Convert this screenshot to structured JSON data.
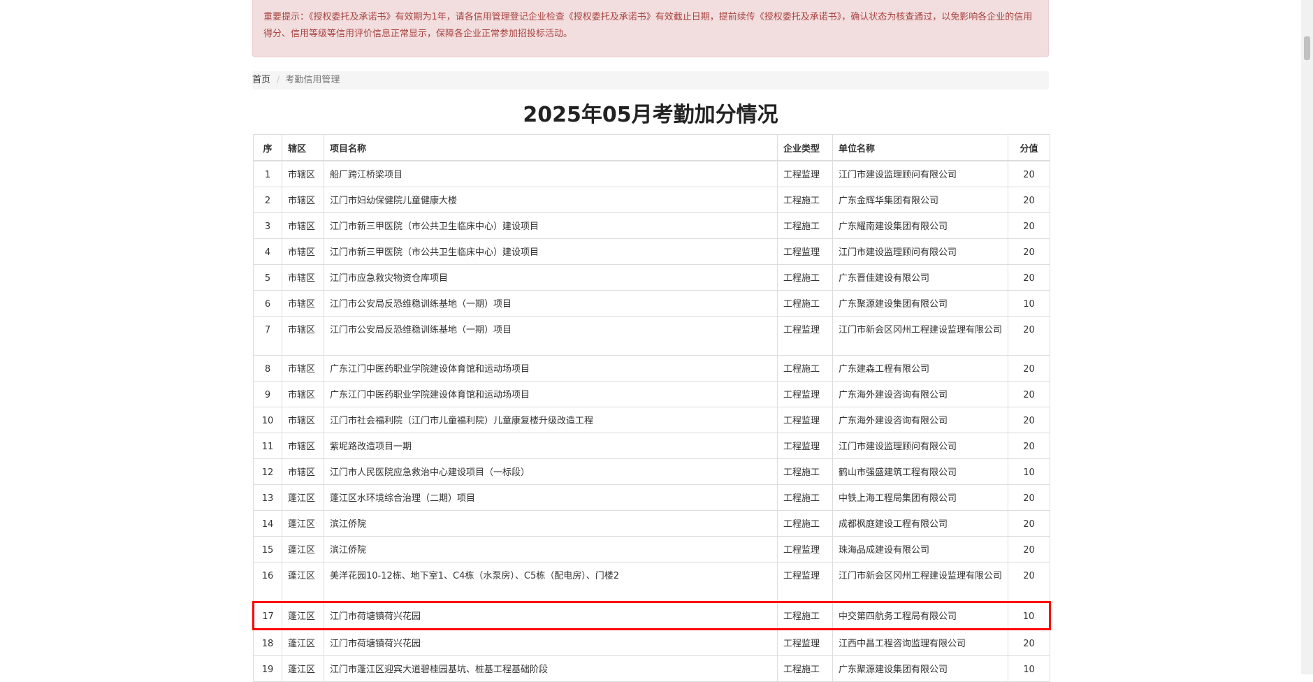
{
  "notice": "重要提示：《授权委托及承诺书》有效期为1年，请各信用管理登记企业检查《授权委托及承诺书》有效截止日期，提前续传《授权委托及承诺书》，确认状态为核查通过，以免影响各企业的信用得分、信用等级等信用评价信息正常显示，保障各企业正常参加招投标活动。",
  "breadcrumb": {
    "home": "首页",
    "separator": "/",
    "current": "考勤信用管理"
  },
  "title": "2025年05月考勤加分情况",
  "table": {
    "headers": [
      "序",
      "辖区",
      "项目名称",
      "企业类型",
      "单位名称",
      "分值"
    ],
    "rows": [
      [
        "1",
        "市辖区",
        "船厂跨江桥梁项目",
        "工程监理",
        "江门市建设监理顾问有限公司",
        "20"
      ],
      [
        "2",
        "市辖区",
        "江门市妇幼保健院儿童健康大楼",
        "工程施工",
        "广东金辉华集团有限公司",
        "20"
      ],
      [
        "3",
        "市辖区",
        "江门市新三甲医院（市公共卫生临床中心）建设项目",
        "工程施工",
        "广东耀南建设集团有限公司",
        "20"
      ],
      [
        "4",
        "市辖区",
        "江门市新三甲医院（市公共卫生临床中心）建设项目",
        "工程监理",
        "江门市建设监理顾问有限公司",
        "20"
      ],
      [
        "5",
        "市辖区",
        "江门市应急救灾物资仓库项目",
        "工程施工",
        "广东晋佳建设有限公司",
        "20"
      ],
      [
        "6",
        "市辖区",
        "江门市公安局反恐维稳训练基地（一期）项目",
        "工程施工",
        "广东聚源建设集团有限公司",
        "10"
      ],
      [
        "7",
        "市辖区",
        "江门市公安局反恐维稳训练基地（一期）项目",
        "工程监理",
        "江门市新会区冈州工程建设监理有限公司",
        "20"
      ],
      [
        "8",
        "市辖区",
        "广东江门中医药职业学院建设体育馆和运动场项目",
        "工程施工",
        "广东建森工程有限公司",
        "20"
      ],
      [
        "9",
        "市辖区",
        "广东江门中医药职业学院建设体育馆和运动场项目",
        "工程监理",
        "广东海外建设咨询有限公司",
        "20"
      ],
      [
        "10",
        "市辖区",
        "江门市社会福利院（江门市儿童福利院）儿童康复楼升级改造工程",
        "工程监理",
        "广东海外建设咨询有限公司",
        "20"
      ],
      [
        "11",
        "市辖区",
        "紫坭路改造项目一期",
        "工程监理",
        "江门市建设监理顾问有限公司",
        "20"
      ],
      [
        "12",
        "市辖区",
        "江门市人民医院应急救治中心建设项目（一标段）",
        "工程施工",
        "鹤山市强盛建筑工程有限公司",
        "10"
      ],
      [
        "13",
        "蓬江区",
        "蓬江区水环境综合治理（二期）项目",
        "工程施工",
        "中铁上海工程局集团有限公司",
        "20"
      ],
      [
        "14",
        "蓬江区",
        "滨江侨院",
        "工程施工",
        "成都枫庭建设工程有限公司",
        "20"
      ],
      [
        "15",
        "蓬江区",
        "滨江侨院",
        "工程监理",
        "珠海品成建设有限公司",
        "20"
      ],
      [
        "16",
        "蓬江区",
        "美洋花园10-12栋、地下室1、C4栋（水泵房）、C5栋（配电房）、门楼2",
        "工程监理",
        "江门市新会区冈州工程建设监理有限公司",
        "20"
      ],
      [
        "17",
        "蓬江区",
        "江门市荷塘镇荷兴花园",
        "工程施工",
        "中交第四航务工程局有限公司",
        "10"
      ],
      [
        "18",
        "蓬江区",
        "江门市荷塘镇荷兴花园",
        "工程监理",
        "江西中昌工程咨询监理有限公司",
        "20"
      ],
      [
        "19",
        "蓬江区",
        "江门市蓬江区迎宾大道碧桂园基坑、桩基工程基础阶段",
        "工程施工",
        "广东聚源建设集团有限公司",
        "10"
      ]
    ]
  },
  "highlighted_row": "17",
  "colors": {
    "alert_bg": "#f2dede",
    "alert_text": "#a94442",
    "highlight_border": "#ff0000"
  }
}
